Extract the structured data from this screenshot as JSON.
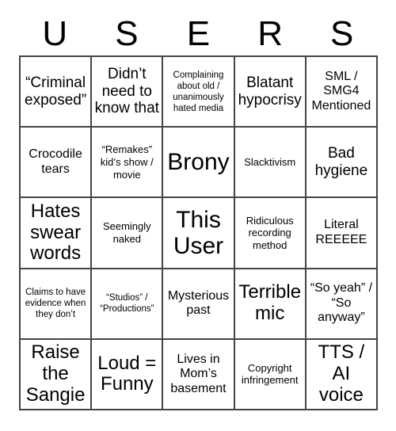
{
  "card": {
    "header_letters": [
      "U",
      "S",
      "E",
      "R",
      "S"
    ],
    "grid": {
      "rows": 5,
      "columns": 5,
      "border_color": "#444444",
      "background_color": "#ffffff",
      "text_color": "#000000"
    },
    "cells": [
      {
        "text": "“Criminal exposed”",
        "size": "l"
      },
      {
        "text": "Didn’t need to know that",
        "size": "l"
      },
      {
        "text": "Complaining about old / unanimously hated media",
        "size": "xs"
      },
      {
        "text": "Blatant hypocrisy",
        "size": "l"
      },
      {
        "text": "SML / SMG4 Mentioned",
        "size": "m"
      },
      {
        "text": "Crocodile tears",
        "size": "m"
      },
      {
        "text": "“Remakes” kid’s show / movie",
        "size": "s"
      },
      {
        "text": "Brony",
        "size": "xxl"
      },
      {
        "text": "Slacktivism",
        "size": "s"
      },
      {
        "text": "Bad hygiene",
        "size": "l"
      },
      {
        "text": "Hates swear words",
        "size": "xl"
      },
      {
        "text": "Seemingly naked",
        "size": "s"
      },
      {
        "text": "This User",
        "size": "xxl"
      },
      {
        "text": "Ridiculous recording method",
        "size": "s"
      },
      {
        "text": "Literal REEEEE",
        "size": "m"
      },
      {
        "text": "Claims to have evidence when they don’t",
        "size": "xs"
      },
      {
        "text": "“Studios” / “Productions”",
        "size": "xs"
      },
      {
        "text": "Mysterious past",
        "size": "m"
      },
      {
        "text": "Terrible mic",
        "size": "xl"
      },
      {
        "text": "“So yeah” / “So anyway”",
        "size": "m"
      },
      {
        "text": "Raise the Sangie",
        "size": "xl"
      },
      {
        "text": "Loud = Funny",
        "size": "xl"
      },
      {
        "text": "Lives in Mom’s basement",
        "size": "m"
      },
      {
        "text": "Copyright infringement",
        "size": "s"
      },
      {
        "text": "TTS / AI voice",
        "size": "xl"
      }
    ]
  }
}
